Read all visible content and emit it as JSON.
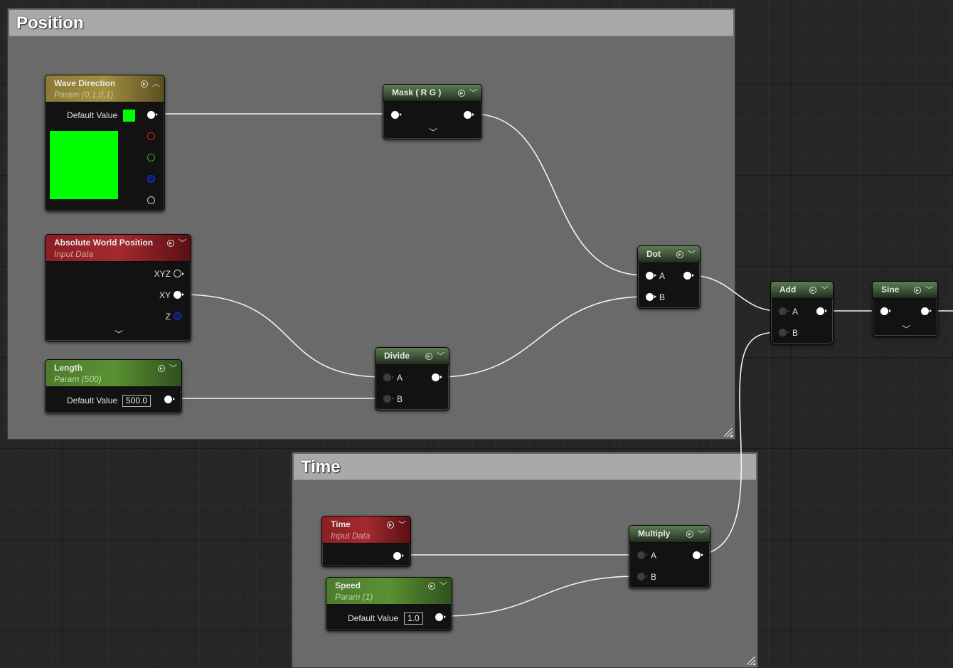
{
  "comments": {
    "position": "Position",
    "time": "Time"
  },
  "nodes": {
    "wave_direction": {
      "title": "Wave Direction",
      "subtitle": "Param (0,1,0,1)",
      "default_label": "Default Value",
      "color": "#00ff00"
    },
    "abs_world_pos": {
      "title": "Absolute World Position",
      "subtitle": "Input Data",
      "pins": [
        "XYZ",
        "XY",
        "Z"
      ]
    },
    "length": {
      "title": "Length",
      "subtitle": "Param (500)",
      "default_label": "Default Value",
      "default_value": "500.0"
    },
    "mask": {
      "title": "Mask ( R G )"
    },
    "divide": {
      "title": "Divide",
      "pin_a": "A",
      "pin_b": "B"
    },
    "dot": {
      "title": "Dot",
      "pin_a": "A",
      "pin_b": "B"
    },
    "add": {
      "title": "Add",
      "pin_a": "A",
      "pin_b": "B"
    },
    "sine": {
      "title": "Sine"
    },
    "time": {
      "title": "Time",
      "subtitle": "Input Data"
    },
    "speed": {
      "title": "Speed",
      "subtitle": "Param (1)",
      "default_label": "Default Value",
      "default_value": "1.0"
    },
    "multiply": {
      "title": "Multiply",
      "pin_a": "A",
      "pin_b": "B"
    }
  },
  "icons": {
    "preview": "preview-play-icon",
    "collapse": "chevron-down-icon",
    "expand": "chevron-up-icon"
  },
  "colors": {
    "channel_r": "#e02020",
    "channel_g": "#20c020",
    "channel_b": "#2030d0",
    "channel_a": "#cccccc",
    "z_pin": "#2030d0"
  }
}
